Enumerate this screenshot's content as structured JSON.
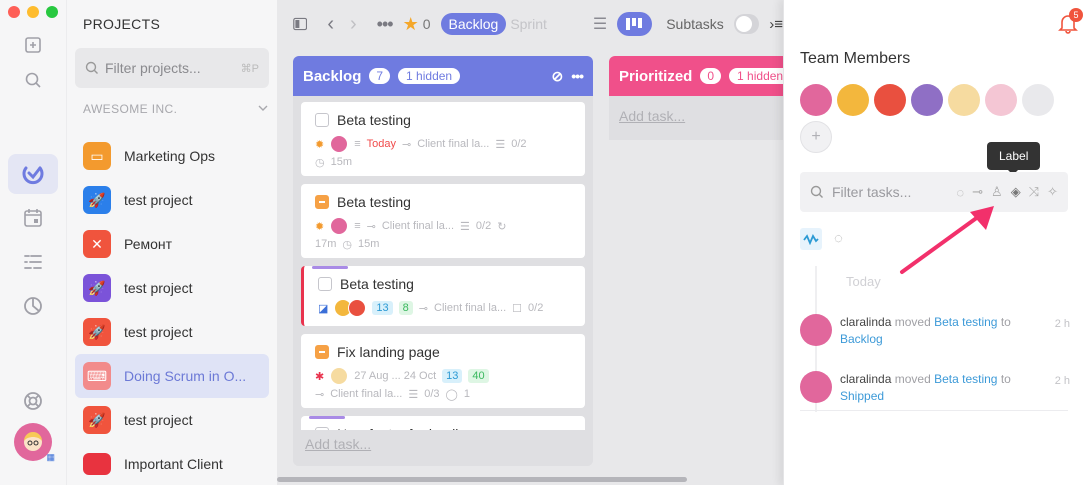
{
  "window": {
    "traffic_colors": [
      "#fe5f57",
      "#febc2e",
      "#28c840"
    ]
  },
  "projects": {
    "title": "PROJECTS",
    "search_placeholder": "Filter projects...",
    "shortcut": "⌘P",
    "org": "AWESOME INC.",
    "items": [
      {
        "label": "Marketing Ops",
        "color": "#f39a2e",
        "icon": "presentation-icon"
      },
      {
        "label": "test project",
        "color": "#2b7fea",
        "icon": "rocket-icon"
      },
      {
        "label": "Ремонт",
        "color": "#f0543d",
        "icon": "tools-icon"
      },
      {
        "label": "test project",
        "color": "#7b53d9",
        "icon": "rocket-icon"
      },
      {
        "label": "test project",
        "color": "#f0543d",
        "icon": "rocket-icon"
      },
      {
        "label": "Doing Scrum in O...",
        "color": "#f28b8b",
        "icon": "typewriter-icon"
      },
      {
        "label": "test project",
        "color": "#f0543d",
        "icon": "rocket-icon"
      },
      {
        "label": "Important Client",
        "color": "#e8333f",
        "icon": "folder-icon"
      }
    ]
  },
  "toolbar": {
    "star_count": "0",
    "tab_backlog": "Backlog",
    "tab_sprint": "Sprint",
    "subtasks": "Subtasks"
  },
  "board": {
    "backlog": {
      "title": "Backlog",
      "count": "7",
      "hidden": "1 hidden",
      "color": "#6f7be0",
      "cards": [
        {
          "title": "Beta testing",
          "date": "Today",
          "link": "Client final la...",
          "checklist": "0/2",
          "estimate": "15m"
        },
        {
          "title": "Beta testing",
          "link": "Client final la...",
          "checklist": "0/2",
          "spent": "17m",
          "estimate": "15m"
        },
        {
          "title": "Beta testing",
          "tag1": "13",
          "tag2": "8",
          "link": "Client final la...",
          "checklist": "0/2"
        },
        {
          "title": "Fix landing page",
          "date": "27 Aug ... 24 Oct",
          "tag1": "13",
          "tag2": "40",
          "link": "Client final la...",
          "checklist": "0/3",
          "comments": "1"
        },
        {
          "title": "New footer for landing page"
        }
      ],
      "add_task": "Add task..."
    },
    "prioritized": {
      "title": "Prioritized",
      "count": "0",
      "hidden": "1 hidden",
      "color": "#f0508a",
      "add_task": "Add task..."
    }
  },
  "panel": {
    "notifications": "5",
    "team_title": "Team Members",
    "members": [
      {
        "color": "#e1679c"
      },
      {
        "color": "#f3b73d"
      },
      {
        "color": "#e9503f"
      },
      {
        "color": "#8f6fc5"
      },
      {
        "color": "#f6dba0"
      },
      {
        "color": "#f4c6d4"
      },
      {
        "color": "#e9e9ec"
      }
    ],
    "filter_placeholder": "Filter tasks...",
    "tooltip": "Label",
    "timeline_today": "Today",
    "activity": [
      {
        "user": "claralinda",
        "verb": "moved",
        "task": "Beta testing",
        "prep": "to",
        "target": "Backlog",
        "time": "2 h"
      },
      {
        "user": "claralinda",
        "verb": "moved",
        "task": "Beta testing",
        "prep": "to",
        "target": "Shipped",
        "time": "2 h"
      }
    ]
  }
}
